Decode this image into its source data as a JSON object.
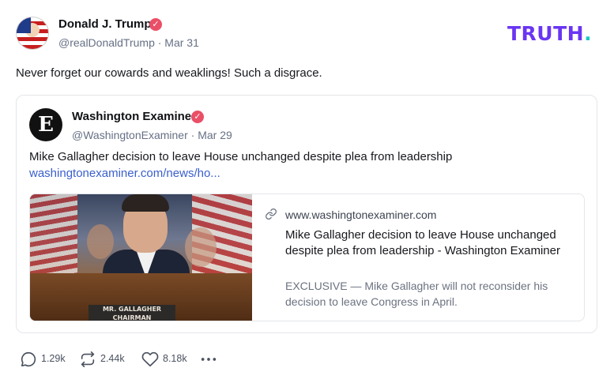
{
  "author": {
    "name": "Donald J. Trump",
    "handle": "@realDonaldTrump",
    "date": "Mar 31",
    "meta": "@realDonaldTrump · Mar 31",
    "verified_symbol": "✓"
  },
  "brand": {
    "text": "TRUTH",
    "dot": ".",
    "color": "#6a35f2",
    "dot_color": "#1ec7c0"
  },
  "post": {
    "text": "Never forget our cowards and weaklings! Such a disgrace."
  },
  "quote": {
    "avatar_letter": "E",
    "name": "Washington Examiner",
    "handle": "@WashingtonExaminer",
    "date": "Mar 29",
    "meta": "@WashingtonExaminer · Mar 29",
    "verified_symbol": "✓",
    "text": "Mike Gallagher decision to leave House unchanged despite plea from leadership",
    "link_text": "washingtonexaminer.com/news/ho...",
    "card": {
      "image_plate_line1": "MR. GALLAGHER",
      "image_plate_line2": "CHAIRMAN",
      "domain": "www.washingtonexaminer.com",
      "title": "Mike Gallagher decision to leave House unchanged despite plea from leadership - Washington Examiner",
      "description": "EXCLUSIVE — Mike Gallagher will not reconsider his decision to leave Congress in April."
    }
  },
  "actions": {
    "replies": "1.29k",
    "retruths": "2.44k",
    "likes": "8.18k"
  },
  "colors": {
    "verified": "#ea4f67",
    "link": "#3a5fcd"
  }
}
